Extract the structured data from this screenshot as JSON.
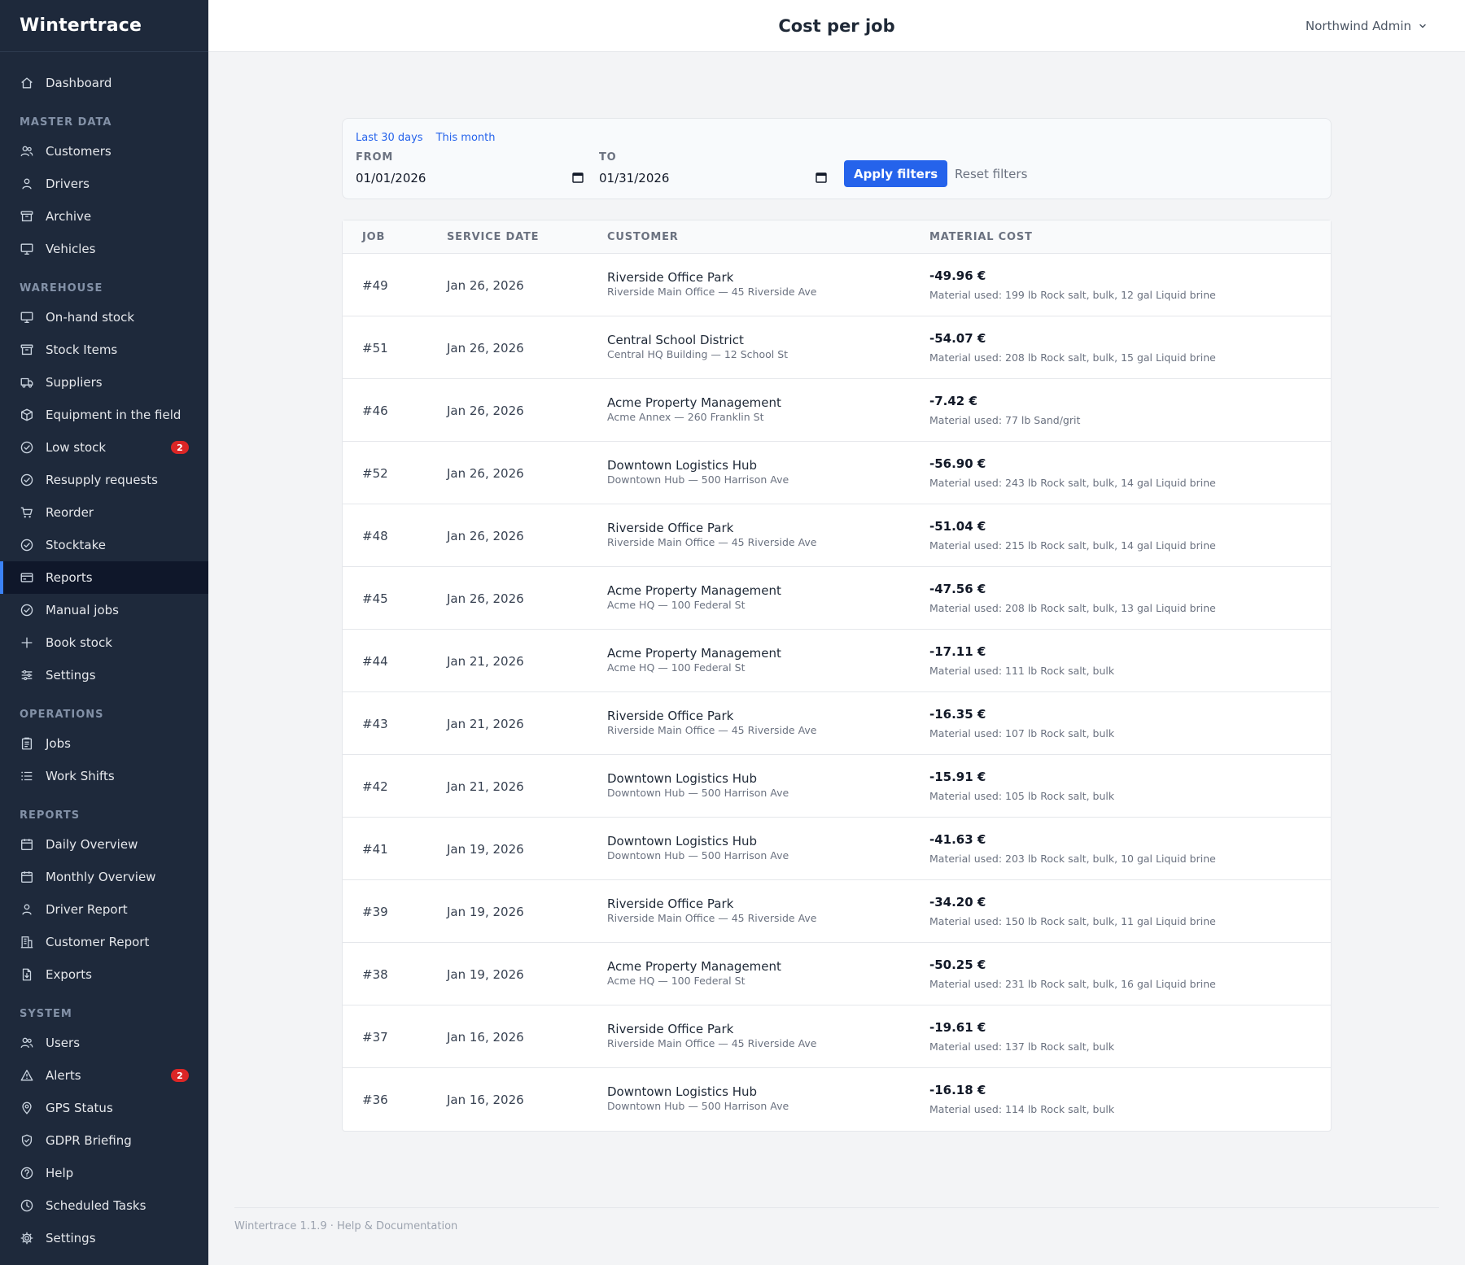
{
  "app": {
    "brand": "Wintertrace"
  },
  "header": {
    "title": "Cost per job",
    "user": "Northwind Admin"
  },
  "sidebar": {
    "groups": [
      {
        "section": "",
        "items": [
          {
            "label": "Dashboard",
            "icon": "home-icon"
          }
        ]
      },
      {
        "section": "MASTER DATA",
        "items": [
          {
            "label": "Customers",
            "icon": "users-icon"
          },
          {
            "label": "Drivers",
            "icon": "user-icon"
          },
          {
            "label": "Archive",
            "icon": "archive-icon"
          },
          {
            "label": "Vehicles",
            "icon": "monitor-icon"
          }
        ]
      },
      {
        "section": "WAREHOUSE",
        "items": [
          {
            "label": "On-hand stock",
            "icon": "monitor-icon"
          },
          {
            "label": "Stock Items",
            "icon": "archive-icon"
          },
          {
            "label": "Suppliers",
            "icon": "truck-icon"
          },
          {
            "label": "Equipment in the field",
            "icon": "cube-icon"
          },
          {
            "label": "Low stock",
            "icon": "check-circle-icon",
            "badge": "2"
          },
          {
            "label": "Resupply requests",
            "icon": "check-circle-icon"
          },
          {
            "label": "Reorder",
            "icon": "cart-icon"
          },
          {
            "label": "Stocktake",
            "icon": "check-circle-icon"
          },
          {
            "label": "Reports",
            "icon": "card-icon",
            "active": true
          },
          {
            "label": "Manual jobs",
            "icon": "check-circle-icon"
          },
          {
            "label": "Book stock",
            "icon": "plus-icon"
          },
          {
            "label": "Settings",
            "icon": "sliders-icon"
          }
        ]
      },
      {
        "section": "OPERATIONS",
        "items": [
          {
            "label": "Jobs",
            "icon": "clipboard-icon"
          },
          {
            "label": "Work Shifts",
            "icon": "list-icon"
          }
        ]
      },
      {
        "section": "REPORTS",
        "items": [
          {
            "label": "Daily Overview",
            "icon": "calendar-icon"
          },
          {
            "label": "Monthly Overview",
            "icon": "calendar-icon"
          },
          {
            "label": "Driver Report",
            "icon": "user-icon"
          },
          {
            "label": "Customer Report",
            "icon": "building-icon"
          },
          {
            "label": "Exports",
            "icon": "download-doc-icon"
          }
        ]
      },
      {
        "section": "SYSTEM",
        "items": [
          {
            "label": "Users",
            "icon": "users-icon"
          },
          {
            "label": "Alerts",
            "icon": "warning-icon",
            "badge": "2"
          },
          {
            "label": "GPS Status",
            "icon": "pin-icon"
          },
          {
            "label": "GDPR Briefing",
            "icon": "shield-icon"
          },
          {
            "label": "Help",
            "icon": "help-icon"
          },
          {
            "label": "Scheduled Tasks",
            "icon": "clock-icon"
          },
          {
            "label": "Settings",
            "icon": "gear-icon"
          }
        ]
      }
    ]
  },
  "filters": {
    "quick_last30": "Last 30 days",
    "quick_month": "This month",
    "from_label": "FROM",
    "from_value": "01/01/2026",
    "to_label": "TO",
    "to_value": "01/31/2026",
    "apply_label": "Apply filters",
    "reset_label": "Reset filters"
  },
  "table": {
    "columns": [
      "JOB",
      "SERVICE DATE",
      "CUSTOMER",
      "MATERIAL COST"
    ],
    "rows": [
      {
        "job": "#49",
        "date": "Jan 26, 2026",
        "customer": "Riverside Office Park",
        "site": "Riverside Main Office — 45 Riverside Ave",
        "cost": "-49.96 €",
        "material": "Material used: 199 lb Rock salt, bulk, 12 gal Liquid brine"
      },
      {
        "job": "#51",
        "date": "Jan 26, 2026",
        "customer": "Central School District",
        "site": "Central HQ Building — 12 School St",
        "cost": "-54.07 €",
        "material": "Material used: 208 lb Rock salt, bulk, 15 gal Liquid brine"
      },
      {
        "job": "#46",
        "date": "Jan 26, 2026",
        "customer": "Acme Property Management",
        "site": "Acme Annex — 260 Franklin St",
        "cost": "-7.42 €",
        "material": "Material used: 77 lb Sand/grit"
      },
      {
        "job": "#52",
        "date": "Jan 26, 2026",
        "customer": "Downtown Logistics Hub",
        "site": "Downtown Hub — 500 Harrison Ave",
        "cost": "-56.90 €",
        "material": "Material used: 243 lb Rock salt, bulk, 14 gal Liquid brine"
      },
      {
        "job": "#48",
        "date": "Jan 26, 2026",
        "customer": "Riverside Office Park",
        "site": "Riverside Main Office — 45 Riverside Ave",
        "cost": "-51.04 €",
        "material": "Material used: 215 lb Rock salt, bulk, 14 gal Liquid brine"
      },
      {
        "job": "#45",
        "date": "Jan 26, 2026",
        "customer": "Acme Property Management",
        "site": "Acme HQ — 100 Federal St",
        "cost": "-47.56 €",
        "material": "Material used: 208 lb Rock salt, bulk, 13 gal Liquid brine"
      },
      {
        "job": "#44",
        "date": "Jan 21, 2026",
        "customer": "Acme Property Management",
        "site": "Acme HQ — 100 Federal St",
        "cost": "-17.11 €",
        "material": "Material used: 111 lb Rock salt, bulk"
      },
      {
        "job": "#43",
        "date": "Jan 21, 2026",
        "customer": "Riverside Office Park",
        "site": "Riverside Main Office — 45 Riverside Ave",
        "cost": "-16.35 €",
        "material": "Material used: 107 lb Rock salt, bulk"
      },
      {
        "job": "#42",
        "date": "Jan 21, 2026",
        "customer": "Downtown Logistics Hub",
        "site": "Downtown Hub — 500 Harrison Ave",
        "cost": "-15.91 €",
        "material": "Material used: 105 lb Rock salt, bulk"
      },
      {
        "job": "#41",
        "date": "Jan 19, 2026",
        "customer": "Downtown Logistics Hub",
        "site": "Downtown Hub — 500 Harrison Ave",
        "cost": "-41.63 €",
        "material": "Material used: 203 lb Rock salt, bulk, 10 gal Liquid brine"
      },
      {
        "job": "#39",
        "date": "Jan 19, 2026",
        "customer": "Riverside Office Park",
        "site": "Riverside Main Office — 45 Riverside Ave",
        "cost": "-34.20 €",
        "material": "Material used: 150 lb Rock salt, bulk, 11 gal Liquid brine"
      },
      {
        "job": "#38",
        "date": "Jan 19, 2026",
        "customer": "Acme Property Management",
        "site": "Acme HQ — 100 Federal St",
        "cost": "-50.25 €",
        "material": "Material used: 231 lb Rock salt, bulk, 16 gal Liquid brine"
      },
      {
        "job": "#37",
        "date": "Jan 16, 2026",
        "customer": "Riverside Office Park",
        "site": "Riverside Main Office — 45 Riverside Ave",
        "cost": "-19.61 €",
        "material": "Material used: 137 lb Rock salt, bulk"
      },
      {
        "job": "#36",
        "date": "Jan 16, 2026",
        "customer": "Downtown Logistics Hub",
        "site": "Downtown Hub — 500 Harrison Ave",
        "cost": "-16.18 €",
        "material": "Material used: 114 lb Rock salt, bulk"
      }
    ]
  },
  "footer": {
    "text": "Wintertrace 1.1.9 · Help & Documentation"
  }
}
